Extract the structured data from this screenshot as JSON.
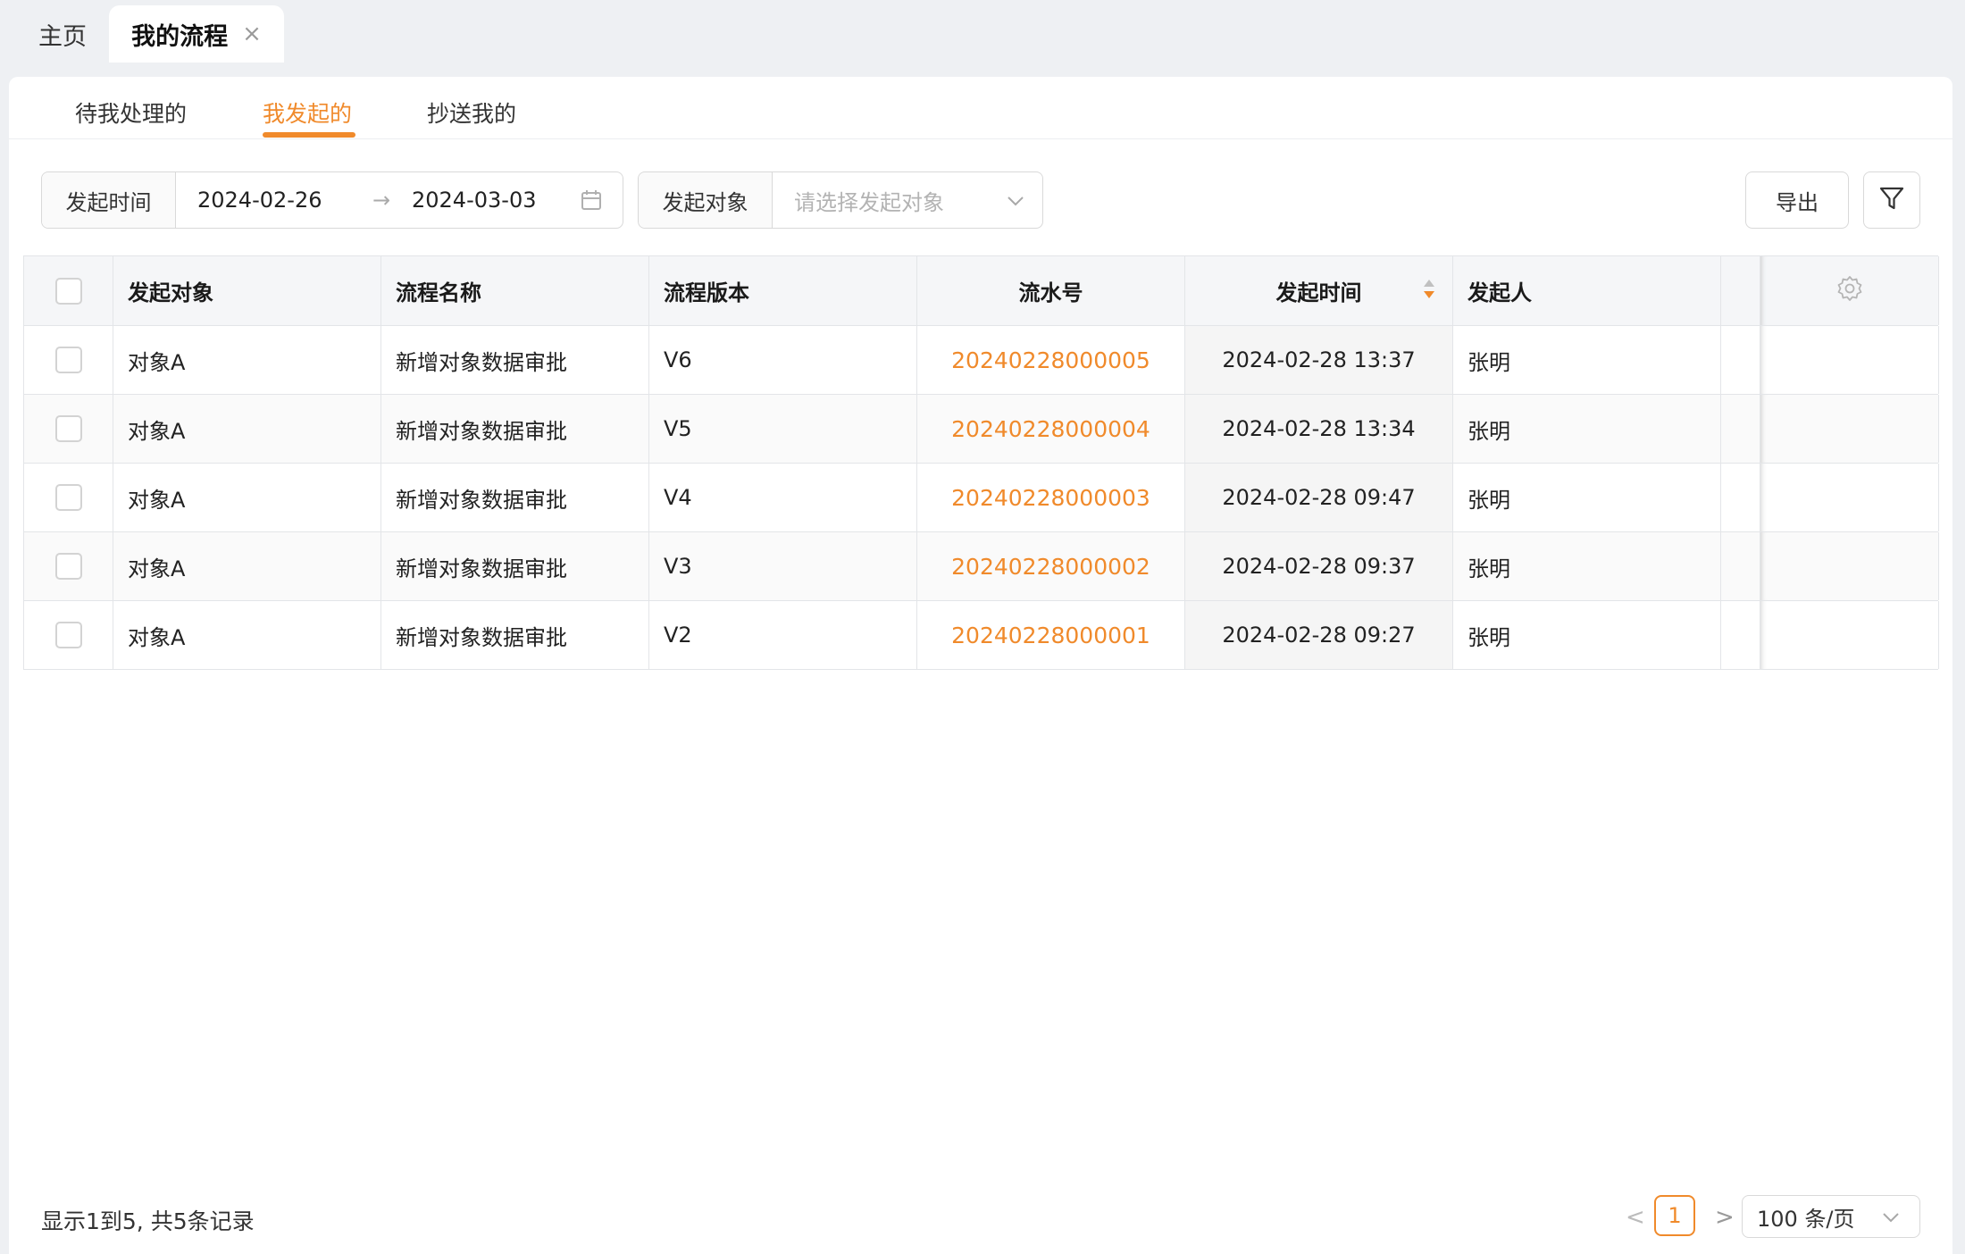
{
  "page_tabs": {
    "home": "主页",
    "active": "我的流程",
    "close": "×"
  },
  "sub_tabs": [
    {
      "label": "待我处理的",
      "active": false
    },
    {
      "label": "我发起的",
      "active": true
    },
    {
      "label": "抄送我的",
      "active": false
    }
  ],
  "filters": {
    "date_label": "发起时间",
    "date_start": "2024-02-26",
    "date_arrow": "→",
    "date_end": "2024-03-03",
    "object_label": "发起对象",
    "object_placeholder": "请选择发起对象"
  },
  "toolbar": {
    "export_label": "导出"
  },
  "table": {
    "headers": {
      "object": "发起对象",
      "name": "流程名称",
      "version": "流程版本",
      "serial": "流水号",
      "time": "发起时间",
      "initiator": "发起人"
    },
    "rows": [
      {
        "object": "对象A",
        "name": "新增对象数据审批",
        "version": "V6",
        "serial": "20240228000005",
        "time": "2024-02-28 13:37",
        "initiator": "张明"
      },
      {
        "object": "对象A",
        "name": "新增对象数据审批",
        "version": "V5",
        "serial": "20240228000004",
        "time": "2024-02-28 13:34",
        "initiator": "张明"
      },
      {
        "object": "对象A",
        "name": "新增对象数据审批",
        "version": "V4",
        "serial": "20240228000003",
        "time": "2024-02-28 09:47",
        "initiator": "张明"
      },
      {
        "object": "对象A",
        "name": "新增对象数据审批",
        "version": "V3",
        "serial": "20240228000002",
        "time": "2024-02-28 09:37",
        "initiator": "张明"
      },
      {
        "object": "对象A",
        "name": "新增对象数据审批",
        "version": "V2",
        "serial": "20240228000001",
        "time": "2024-02-28 09:27",
        "initiator": "张明"
      }
    ]
  },
  "footer": {
    "info": "显示1到5, 共5条记录",
    "prev": "<",
    "current_page": "1",
    "next": ">",
    "page_size": "100 条/页"
  },
  "colors": {
    "accent": "#f08a2b",
    "border": "#d9d9d9",
    "background": "#eef0f3"
  },
  "icons": [
    "close-icon",
    "calendar-icon",
    "chevron-down-icon",
    "filter-icon",
    "settings-gear-icon",
    "sort-icon"
  ]
}
